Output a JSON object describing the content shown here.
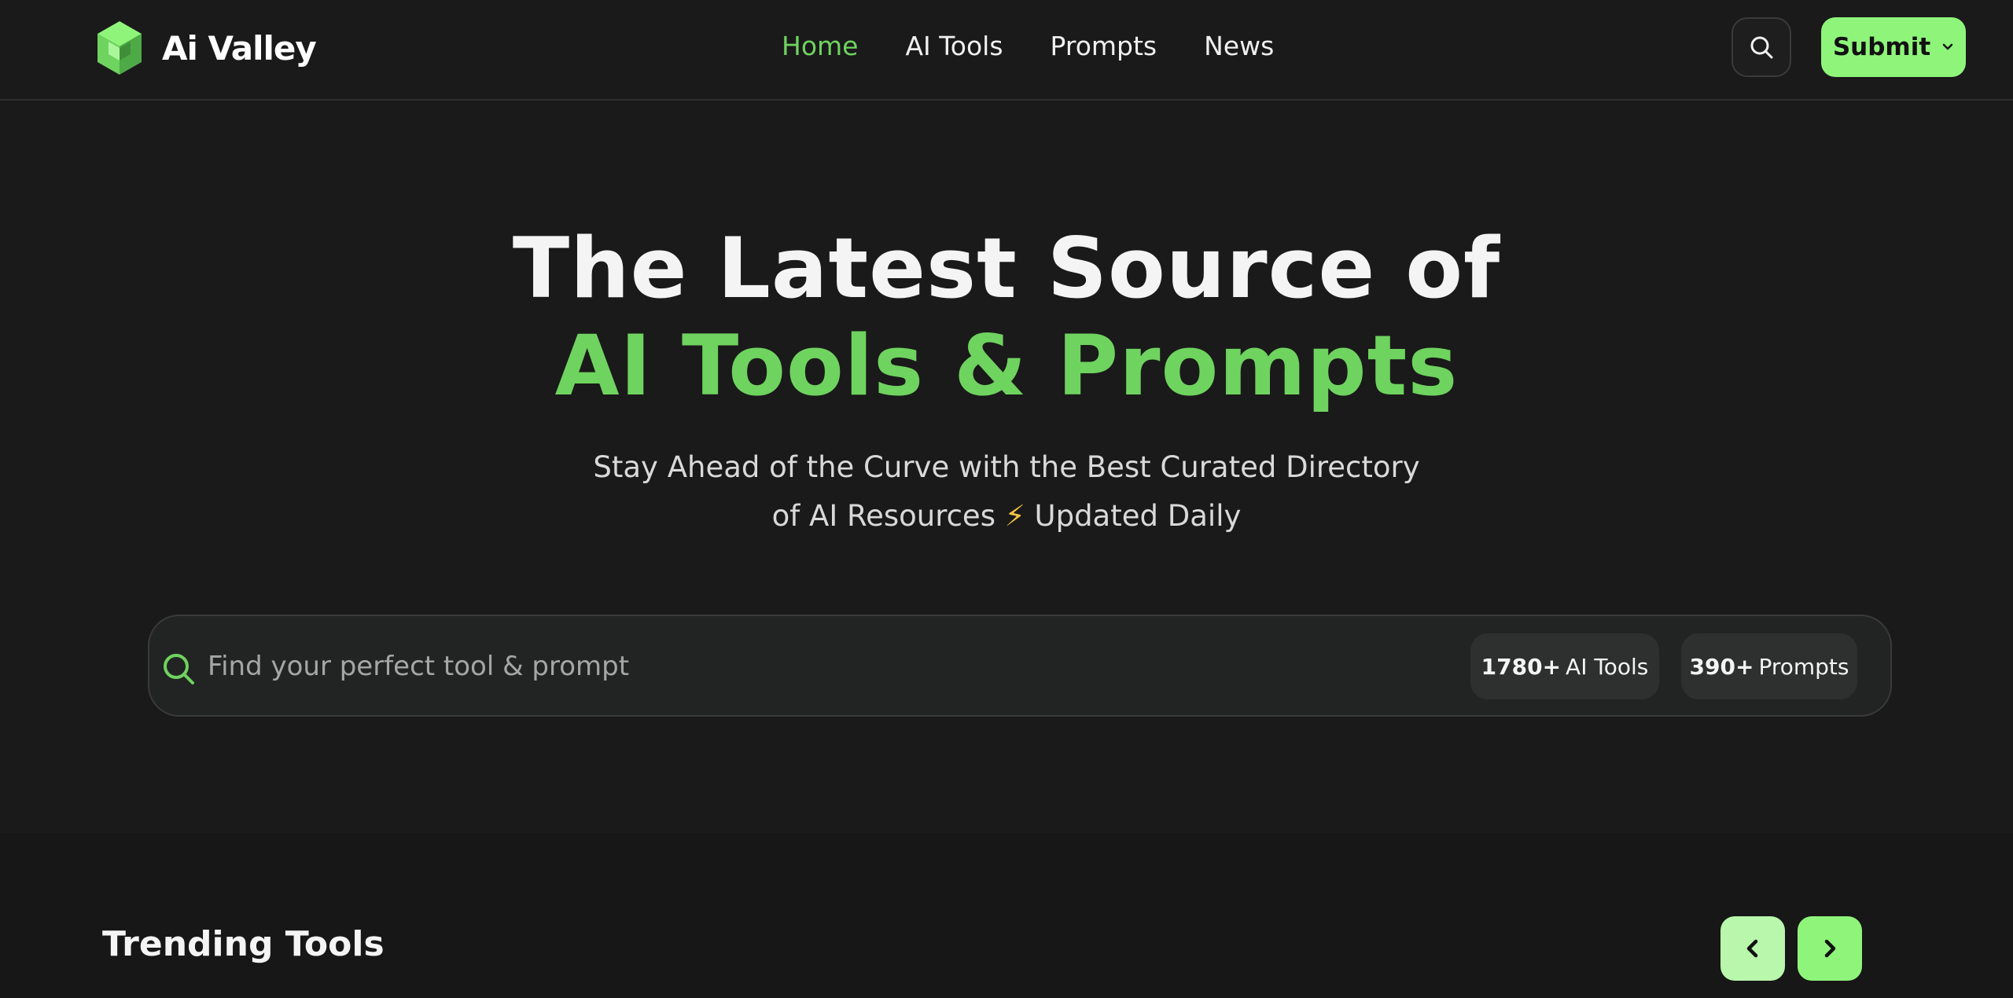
{
  "brand": {
    "name": "Ai Valley",
    "accent": "#8ff57a",
    "accent_text": "#6fd35f"
  },
  "nav": {
    "items": [
      {
        "label": "Home",
        "active": true
      },
      {
        "label": "AI Tools",
        "active": false
      },
      {
        "label": "Prompts",
        "active": false
      },
      {
        "label": "News",
        "active": false
      }
    ]
  },
  "header": {
    "search_icon": "search-icon",
    "submit_label": "Submit",
    "submit_icon": "chevron-down-icon"
  },
  "hero": {
    "title_line1": "The Latest Source of",
    "title_line2": "AI Tools & Prompts",
    "subtitle_line1": "Stay Ahead of the Curve with the Best Curated Directory",
    "subtitle_line2_pre": "of AI Resources",
    "subtitle_bolt": "⚡",
    "subtitle_line2_post": "Updated Daily"
  },
  "search": {
    "placeholder": "Find your perfect tool & prompt",
    "value": "",
    "tools_count": "1780+",
    "tools_label": "AI Tools",
    "prompts_count": "390+",
    "prompts_label": "Prompts"
  },
  "trending": {
    "title": "Trending Tools",
    "prev_icon": "chevron-left-icon",
    "next_icon": "chevron-right-icon"
  }
}
